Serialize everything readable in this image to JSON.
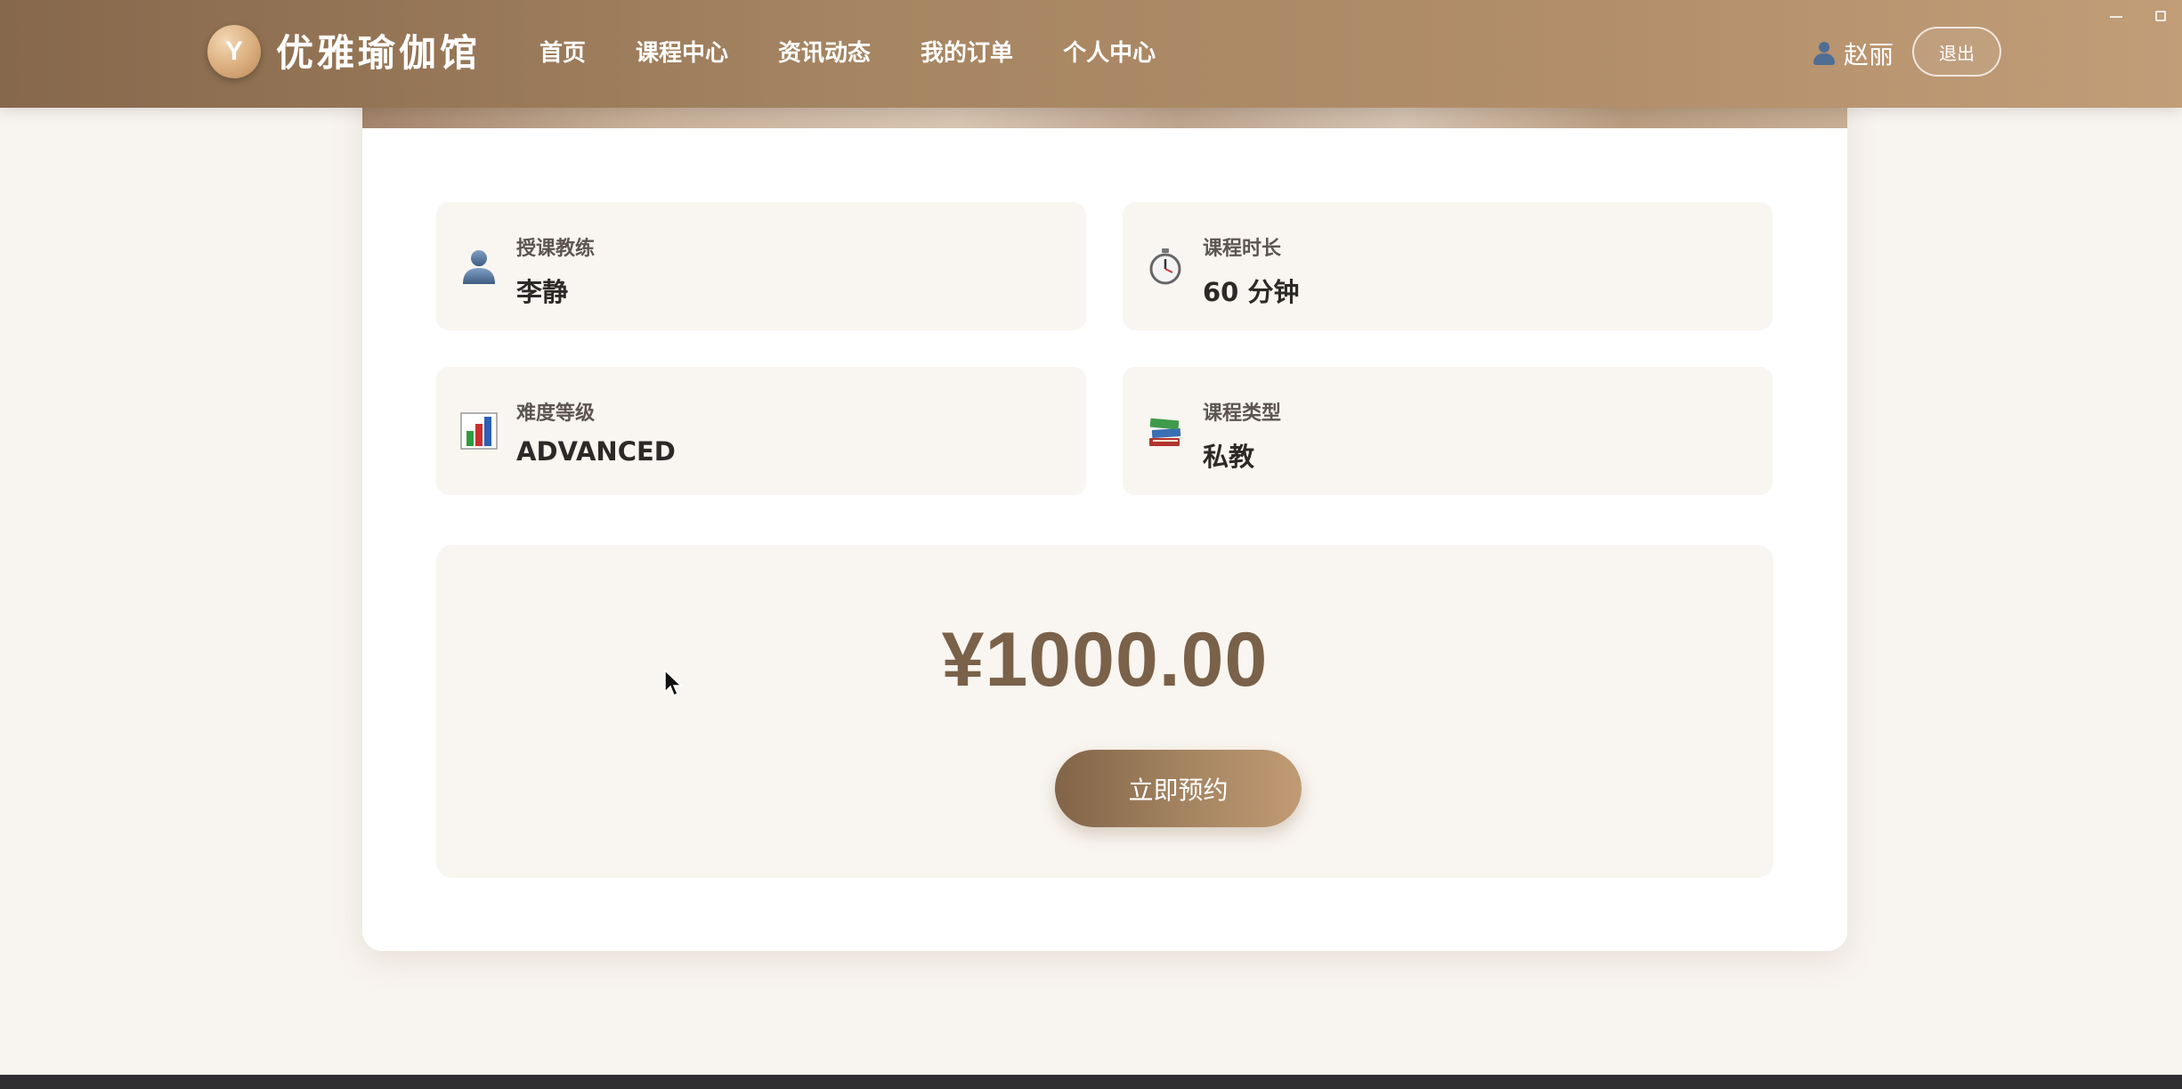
{
  "header": {
    "logo_letter": "Y",
    "brand_name": "优雅瑜伽馆",
    "nav": [
      "首页",
      "课程中心",
      "资讯动态",
      "我的订单",
      "个人中心"
    ],
    "user_name": "赵丽",
    "logout_label": "退出"
  },
  "course": {
    "info": [
      {
        "icon": "coach-icon",
        "label": "授课教练",
        "value": "李静"
      },
      {
        "icon": "stopwatch-icon",
        "label": "课程时长",
        "value": "60 分钟"
      },
      {
        "icon": "bar-chart-icon",
        "label": "难度等级",
        "value": "ADVANCED"
      },
      {
        "icon": "books-icon",
        "label": "课程类型",
        "value": "私教"
      }
    ],
    "price": "¥1000.00",
    "book_label": "立即预约"
  },
  "colors": {
    "header_start": "#86684c",
    "header_end": "#c19d78",
    "price": "#7a6149",
    "panel_bg": "#f9f5f0",
    "page_bg": "#f8f4ef"
  }
}
